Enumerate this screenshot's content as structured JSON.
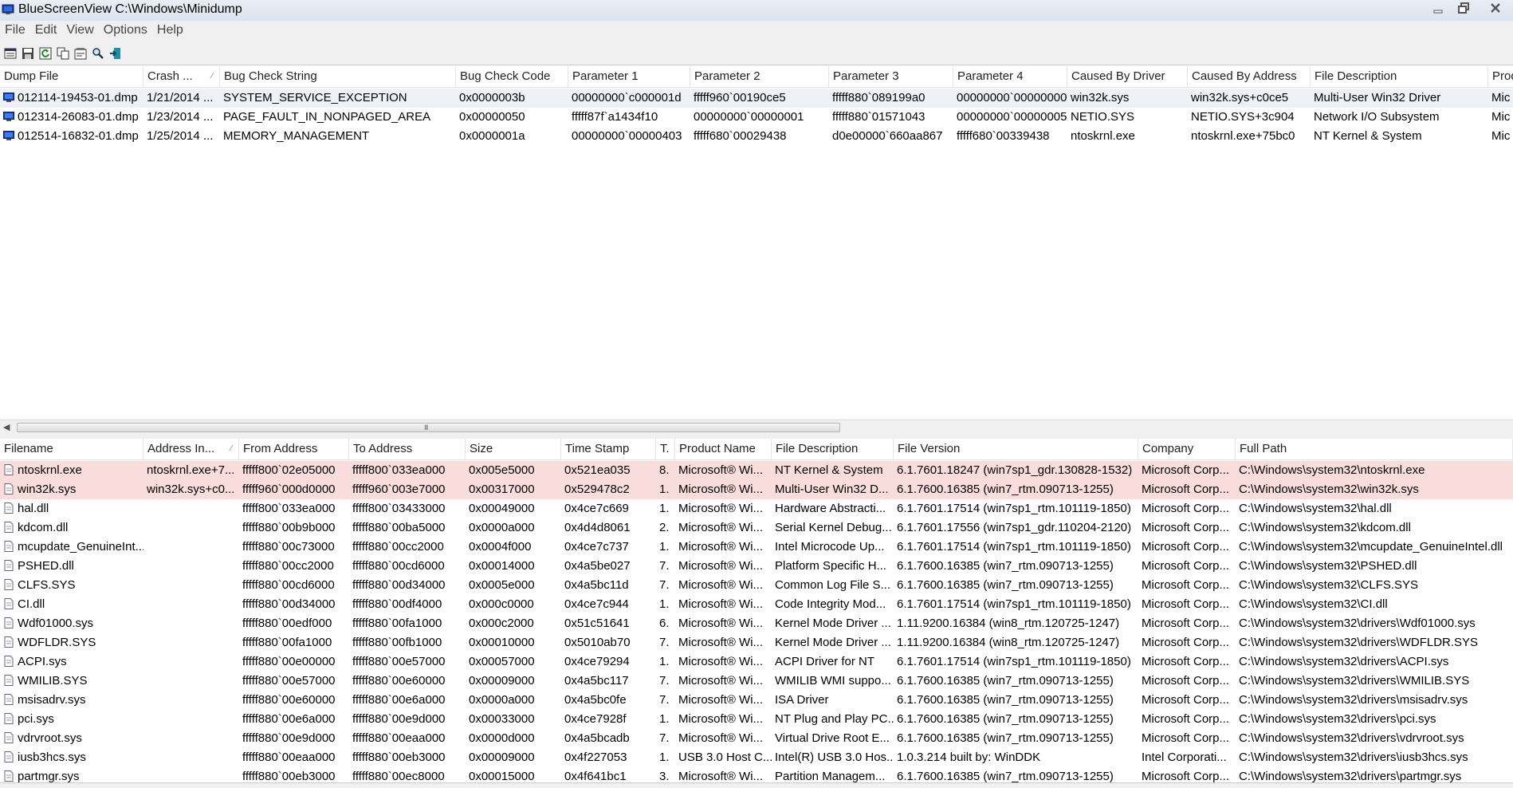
{
  "window": {
    "title": "BlueScreenView    C:\\Windows\\Minidump"
  },
  "menu": [
    "File",
    "Edit",
    "View",
    "Options",
    "Help"
  ],
  "toolbar_icons": [
    "html-report-icon",
    "save-icon",
    "refresh-icon",
    "copy-icon",
    "properties-icon",
    "find-icon",
    "exit-icon"
  ],
  "colors": {
    "highlight_row": "#f9dcdc",
    "selected_row": "#eef2f7"
  },
  "top": {
    "columns": [
      "Dump File",
      "Crash ...",
      "Bug Check String",
      "Bug Check Code",
      "Parameter 1",
      "Parameter 2",
      "Parameter 3",
      "Parameter 4",
      "Caused By Driver",
      "Caused By Address",
      "File Description",
      "Prod"
    ],
    "rows": [
      [
        "012114-19453-01.dmp",
        "1/21/2014 ...",
        "SYSTEM_SERVICE_EXCEPTION",
        "0x0000003b",
        "00000000`c000001d",
        "fffff960`00190ce5",
        "fffff880`089199a0",
        "00000000`00000000",
        "win32k.sys",
        "win32k.sys+c0ce5",
        "Multi-User Win32 Driver",
        "Mic"
      ],
      [
        "012314-26083-01.dmp",
        "1/23/2014 ...",
        "PAGE_FAULT_IN_NONPAGED_AREA",
        "0x00000050",
        "fffff87f`a1434f10",
        "00000000`00000001",
        "fffff880`01571043",
        "00000000`00000005",
        "NETIO.SYS",
        "NETIO.SYS+3c904",
        "Network I/O Subsystem",
        "Mic"
      ],
      [
        "012514-16832-01.dmp",
        "1/25/2014 ...",
        "MEMORY_MANAGEMENT",
        "0x0000001a",
        "00000000`00000403",
        "fffff680`00029438",
        "d0e00000`660aa867",
        "fffff680`00339438",
        "ntoskrnl.exe",
        "ntoskrnl.exe+75bc0",
        "NT Kernel & System",
        "Mic"
      ]
    ]
  },
  "scrollbar": {
    "grip": "III"
  },
  "bottom": {
    "columns": [
      "Filename",
      "Address In...",
      "From Address",
      "To Address",
      "Size",
      "Time Stamp",
      "T.",
      "Product Name",
      "File Description",
      "File Version",
      "Company",
      "Full Path"
    ],
    "rows": [
      [
        "ntoskrnl.exe",
        "ntoskrnl.exe+7...",
        "fffff800`02e05000",
        "fffff800`033ea000",
        "0x005e5000",
        "0x521ea035",
        "8.",
        "Microsoft® Wi...",
        "NT Kernel & System",
        "6.1.7601.18247 (win7sp1_gdr.130828-1532)",
        "Microsoft Corp...",
        "C:\\Windows\\system32\\ntoskrnl.exe"
      ],
      [
        "win32k.sys",
        "win32k.sys+c0...",
        "fffff960`000d0000",
        "fffff960`003e7000",
        "0x00317000",
        "0x529478c2",
        "1.",
        "Microsoft® Wi...",
        "Multi-User Win32 D...",
        "6.1.7600.16385 (win7_rtm.090713-1255)",
        "Microsoft Corp...",
        "C:\\Windows\\system32\\win32k.sys"
      ],
      [
        "hal.dll",
        "",
        "fffff800`033ea000",
        "fffff800`03433000",
        "0x00049000",
        "0x4ce7c669",
        "1.",
        "Microsoft® Wi...",
        "Hardware Abstracti...",
        "6.1.7601.17514 (win7sp1_rtm.101119-1850)",
        "Microsoft Corp...",
        "C:\\Windows\\system32\\hal.dll"
      ],
      [
        "kdcom.dll",
        "",
        "fffff880`00b9b000",
        "fffff880`00ba5000",
        "0x0000a000",
        "0x4d4d8061",
        "2.",
        "Microsoft® Wi...",
        "Serial Kernel Debug...",
        "6.1.7601.17556 (win7sp1_gdr.110204-2120)",
        "Microsoft Corp...",
        "C:\\Windows\\system32\\kdcom.dll"
      ],
      [
        "mcupdate_GenuineInt...",
        "",
        "fffff880`00c73000",
        "fffff880`00cc2000",
        "0x0004f000",
        "0x4ce7c737",
        "1.",
        "Microsoft® Wi...",
        "Intel Microcode Up...",
        "6.1.7601.17514 (win7sp1_rtm.101119-1850)",
        "Microsoft Corp...",
        "C:\\Windows\\system32\\mcupdate_GenuineIntel.dll"
      ],
      [
        "PSHED.dll",
        "",
        "fffff880`00cc2000",
        "fffff880`00cd6000",
        "0x00014000",
        "0x4a5be027",
        "7.",
        "Microsoft® Wi...",
        "Platform Specific H...",
        "6.1.7600.16385 (win7_rtm.090713-1255)",
        "Microsoft Corp...",
        "C:\\Windows\\system32\\PSHED.dll"
      ],
      [
        "CLFS.SYS",
        "",
        "fffff880`00cd6000",
        "fffff880`00d34000",
        "0x0005e000",
        "0x4a5bc11d",
        "7.",
        "Microsoft® Wi...",
        "Common Log File S...",
        "6.1.7600.16385 (win7_rtm.090713-1255)",
        "Microsoft Corp...",
        "C:\\Windows\\system32\\CLFS.SYS"
      ],
      [
        "CI.dll",
        "",
        "fffff880`00d34000",
        "fffff880`00df4000",
        "0x000c0000",
        "0x4ce7c944",
        "1.",
        "Microsoft® Wi...",
        "Code Integrity Mod...",
        "6.1.7601.17514 (win7sp1_rtm.101119-1850)",
        "Microsoft Corp...",
        "C:\\Windows\\system32\\CI.dll"
      ],
      [
        "Wdf01000.sys",
        "",
        "fffff880`00edf000",
        "fffff880`00fa1000",
        "0x000c2000",
        "0x51c51641",
        "6.",
        "Microsoft® Wi...",
        "Kernel Mode Driver ...",
        "1.11.9200.16384 (win8_rtm.120725-1247)",
        "Microsoft Corp...",
        "C:\\Windows\\system32\\drivers\\Wdf01000.sys"
      ],
      [
        "WDFLDR.SYS",
        "",
        "fffff880`00fa1000",
        "fffff880`00fb1000",
        "0x00010000",
        "0x5010ab70",
        "7.",
        "Microsoft® Wi...",
        "Kernel Mode Driver ...",
        "1.11.9200.16384 (win8_rtm.120725-1247)",
        "Microsoft Corp...",
        "C:\\Windows\\system32\\drivers\\WDFLDR.SYS"
      ],
      [
        "ACPI.sys",
        "",
        "fffff880`00e00000",
        "fffff880`00e57000",
        "0x00057000",
        "0x4ce79294",
        "1.",
        "Microsoft® Wi...",
        "ACPI Driver for NT",
        "6.1.7601.17514 (win7sp1_rtm.101119-1850)",
        "Microsoft Corp...",
        "C:\\Windows\\system32\\drivers\\ACPI.sys"
      ],
      [
        "WMILIB.SYS",
        "",
        "fffff880`00e57000",
        "fffff880`00e60000",
        "0x00009000",
        "0x4a5bc117",
        "7.",
        "Microsoft® Wi...",
        "WMILIB WMI suppo...",
        "6.1.7600.16385 (win7_rtm.090713-1255)",
        "Microsoft Corp...",
        "C:\\Windows\\system32\\drivers\\WMILIB.SYS"
      ],
      [
        "msisadrv.sys",
        "",
        "fffff880`00e60000",
        "fffff880`00e6a000",
        "0x0000a000",
        "0x4a5bc0fe",
        "7.",
        "Microsoft® Wi...",
        "ISA Driver",
        "6.1.7600.16385 (win7_rtm.090713-1255)",
        "Microsoft Corp...",
        "C:\\Windows\\system32\\drivers\\msisadrv.sys"
      ],
      [
        "pci.sys",
        "",
        "fffff880`00e6a000",
        "fffff880`00e9d000",
        "0x00033000",
        "0x4ce7928f",
        "1.",
        "Microsoft® Wi...",
        "NT Plug and Play PC...",
        "6.1.7600.16385 (win7_rtm.090713-1255)",
        "Microsoft Corp...",
        "C:\\Windows\\system32\\drivers\\pci.sys"
      ],
      [
        "vdrvroot.sys",
        "",
        "fffff880`00e9d000",
        "fffff880`00eaa000",
        "0x0000d000",
        "0x4a5bcadb",
        "7.",
        "Microsoft® Wi...",
        "Virtual Drive Root E...",
        "6.1.7600.16385 (win7_rtm.090713-1255)",
        "Microsoft Corp...",
        "C:\\Windows\\system32\\drivers\\vdrvroot.sys"
      ],
      [
        "iusb3hcs.sys",
        "",
        "fffff880`00eaa000",
        "fffff880`00eb3000",
        "0x00009000",
        "0x4f227053",
        "1.",
        "USB 3.0 Host C...",
        "Intel(R) USB 3.0 Hos...",
        "1.0.3.214 built by: WinDDK",
        "Intel Corporati...",
        "C:\\Windows\\system32\\drivers\\iusb3hcs.sys"
      ],
      [
        "partmgr.sys",
        "",
        "fffff880`00eb3000",
        "fffff880`00ec8000",
        "0x00015000",
        "0x4f641bc1",
        "3.",
        "Microsoft® Wi...",
        "Partition Managem...",
        "6.1.7600.16385 (win7_rtm.090713-1255)",
        "Microsoft Corp...",
        "C:\\Windows\\system32\\drivers\\partmgr.sys"
      ]
    ]
  }
}
